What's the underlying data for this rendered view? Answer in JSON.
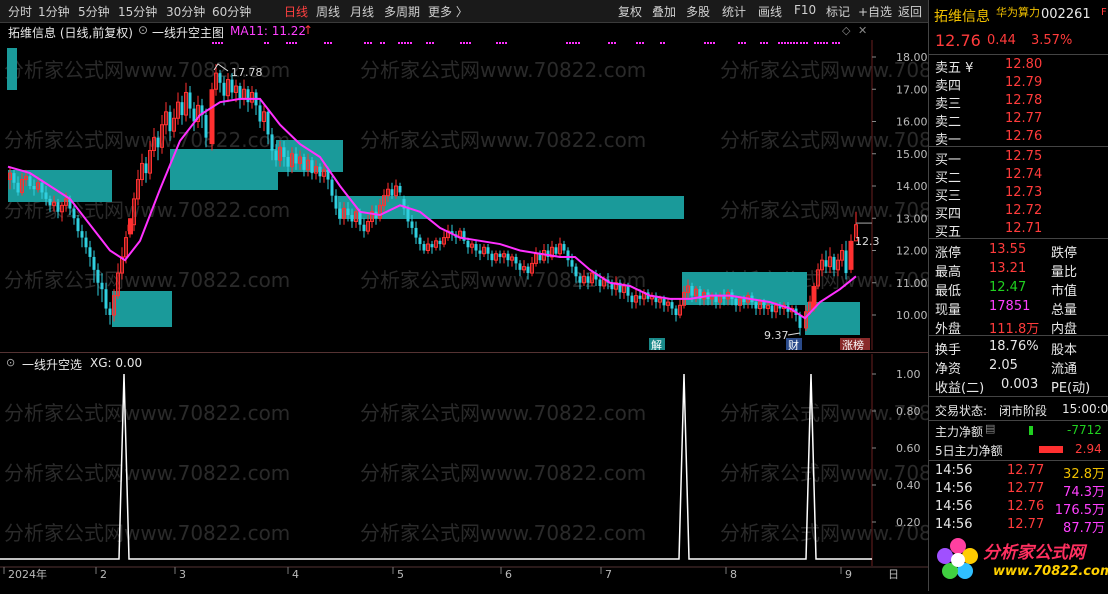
{
  "toolbar": {
    "left_items": [
      "分时",
      "1分钟",
      "5分钟",
      "15分钟",
      "30分钟",
      "60分钟",
      "日线",
      "周线",
      "月线",
      "多周期",
      "更多 〉"
    ],
    "active": "日线",
    "right_items": [
      "复权",
      "叠加",
      "多股",
      "统计",
      "画线",
      "F10",
      "标记",
      "+自选",
      "返回"
    ]
  },
  "chart_header": {
    "title": "拓维信息 (日线,前复权)",
    "indicator_name": "一线升空主图",
    "ma_label": "MA11: 11.22",
    "ma_arrow": "↑"
  },
  "main_axis": {
    "labels": [
      "18.00",
      "17.00",
      "16.00",
      "15.00",
      "14.00",
      "13.00",
      "12.00",
      "11.00",
      "10.00"
    ],
    "current_price_tag": "12.3"
  },
  "annotations": {
    "high": "17.78",
    "low": "9.37",
    "tag_jie": "解",
    "tag_cai": "财",
    "tag_zhangbang": "涨榜"
  },
  "indicator": {
    "title": "一线升空选",
    "xg_label": "XG: 0.00",
    "axis_labels": [
      "1.00",
      "0.80",
      "0.60",
      "0.40",
      "0.20"
    ]
  },
  "time_axis": {
    "labels": [
      "2024年",
      "2",
      "3",
      "4",
      "5",
      "6",
      "7",
      "8",
      "9"
    ],
    "right_label": "日"
  },
  "colors": {
    "up": "#ff3030",
    "down": "#30d0e0",
    "ma": "#ff30ff",
    "box": "#1a9a9a",
    "accent": "#ff4040"
  },
  "watermark": "分析家公式网www.70822.com",
  "stock": {
    "name": "拓维信息",
    "tag": "华为算力",
    "code": "002261",
    "price": "12.76",
    "change": "0.44",
    "change_pct": "3.57%"
  },
  "order_book": {
    "sell": [
      {
        "label": "卖五 ¥",
        "price": "12.80"
      },
      {
        "label": "卖四",
        "price": "12.79"
      },
      {
        "label": "卖三",
        "price": "12.78"
      },
      {
        "label": "卖二",
        "price": "12.77"
      },
      {
        "label": "卖一",
        "price": "12.76"
      }
    ],
    "buy": [
      {
        "label": "买一",
        "price": "12.75"
      },
      {
        "label": "买二",
        "price": "12.74"
      },
      {
        "label": "买三",
        "price": "12.73"
      },
      {
        "label": "买四",
        "price": "12.72"
      },
      {
        "label": "买五",
        "price": "12.71"
      }
    ]
  },
  "stats": [
    {
      "k1": "涨停",
      "v1": "13.55",
      "k2": "跌停"
    },
    {
      "k1": "最高",
      "v1": "13.21",
      "k2": "量比"
    },
    {
      "k1": "最低",
      "v1": "12.47",
      "k2": "市值"
    },
    {
      "k1": "现量",
      "v1": "17851",
      "k2": "总量"
    },
    {
      "k1": "外盘",
      "v1": "111.8万",
      "k2": "内盘"
    }
  ],
  "stats2": [
    {
      "k1": "换手",
      "v1": "18.76%",
      "k2": "股本"
    },
    {
      "k1": "净资",
      "v1": "2.05",
      "k2": "流通"
    },
    {
      "k1": "收益(二)",
      "v1": "0.003",
      "k2": "PE(动)"
    }
  ],
  "trade_status": {
    "label": "交易状态:",
    "value": "闭市阶段",
    "time": "15:00:0"
  },
  "flows": [
    {
      "label": "主力净额",
      "value": "-7712"
    },
    {
      "label": "5日主力净额",
      "value": "2.94"
    }
  ],
  "ticks": [
    {
      "time": "14:56",
      "price": "12.77",
      "vol": "32.8万"
    },
    {
      "time": "14:56",
      "price": "12.77",
      "vol": "74.3万"
    },
    {
      "time": "14:56",
      "price": "12.76",
      "vol": "176.5万"
    },
    {
      "time": "14:56",
      "price": "12.77",
      "vol": "87.7万"
    }
  ],
  "logo": {
    "name": "分析家公式网",
    "url": "www.70822.com"
  },
  "chart_data": [
    {
      "type": "candlestick",
      "title": "拓维信息 (日线,前复权)",
      "y_range": [
        9.3,
        18.3
      ],
      "series": [
        {
          "name": "MA11",
          "values": [
            11.22
          ]
        }
      ],
      "annotations": [
        {
          "text": "17.78"
        },
        {
          "text": "9.37"
        }
      ],
      "boxes": [
        {
          "from": "2024-01",
          "to": "2024-01",
          "low": 13.6,
          "high": 14.6
        },
        {
          "from": "2024-02",
          "to": "2024-02",
          "low": 9.7,
          "high": 10.8
        },
        {
          "from": "2024-03",
          "to": "2024-04",
          "low": 13.9,
          "high": 14.9
        },
        {
          "from": "2024-04",
          "to": "2024-04",
          "low": 14.4,
          "high": 15.4
        },
        {
          "from": "2024-04",
          "to": "2024-07",
          "low": 12.9,
          "high": 13.6
        },
        {
          "from": "2024-07",
          "to": "2024-08",
          "low": 10.4,
          "high": 11.3
        },
        {
          "from": "2024-08",
          "to": "2024-09",
          "low": 9.4,
          "high": 10.4
        }
      ]
    },
    {
      "type": "line",
      "title": "一线升空选",
      "ylim": [
        0,
        1
      ],
      "series": [
        {
          "name": "XG",
          "spikes_at": [
            "2024-02",
            "2024-07",
            "2024-08"
          ],
          "peak": 1.0
        }
      ]
    }
  ]
}
